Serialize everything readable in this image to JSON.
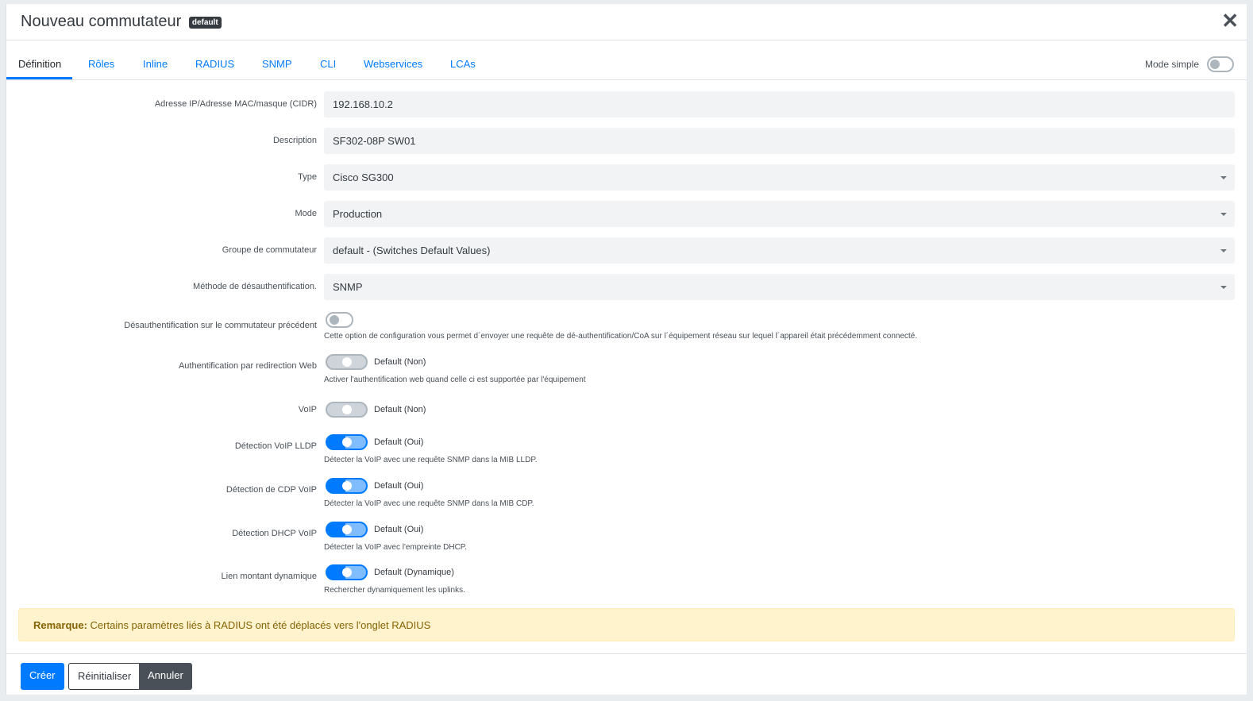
{
  "header": {
    "title": "Nouveau commutateur",
    "badge": "default",
    "close_symbol": "✕"
  },
  "tabs": [
    {
      "label": "Définition",
      "active": true
    },
    {
      "label": "Rôles"
    },
    {
      "label": "Inline"
    },
    {
      "label": "RADIUS"
    },
    {
      "label": "SNMP"
    },
    {
      "label": "CLI"
    },
    {
      "label": "Webservices"
    },
    {
      "label": "LCAs"
    }
  ],
  "mode_simple": {
    "label": "Mode simple",
    "enabled": false
  },
  "fields": {
    "ip": {
      "label": "Adresse IP/Adresse MAC/masque (CIDR)",
      "value": "192.168.10.2"
    },
    "description": {
      "label": "Description",
      "value": "SF302-08P SW01"
    },
    "type": {
      "label": "Type",
      "value": "Cisco SG300"
    },
    "mode": {
      "label": "Mode",
      "value": "Production"
    },
    "group": {
      "label": "Groupe de commutateur",
      "value": "default - (Switches Default Values)"
    },
    "deauth": {
      "label": "Méthode de désauthentification.",
      "value": "SNMP"
    }
  },
  "toggles": {
    "previous_switch": {
      "label": "Désauthentification sur le commutateur précédent",
      "state": "off",
      "help": "Cette option de configuration vous permet d´envoyer une requête de dé-authentification/CoA sur l´équipement réseau sur lequel l´appareil était précédemment connecté."
    },
    "web_auth": {
      "label": "Authentification par redirection Web",
      "state": "default-off",
      "text": "Default (Non)",
      "help": "Activer l'authentification web quand celle ci est supportée par l'équipement"
    },
    "voip": {
      "label": "VoIP",
      "state": "default-off",
      "text": "Default (Non)"
    },
    "lldp": {
      "label": "Détection VoIP LLDP",
      "state": "default-on",
      "text": "Default (Oui)",
      "help": "Détecter la VoIP avec une requête SNMP dans la MIB LLDP."
    },
    "cdp": {
      "label": "Détection de CDP VoIP",
      "state": "default-on",
      "text": "Default (Oui)",
      "help": "Détecter la VoIP avec une requête SNMP dans la MIB CDP."
    },
    "dhcp": {
      "label": "Détection DHCP VoIP",
      "state": "default-on",
      "text": "Default (Oui)",
      "help": "Détecter la VoIP avec l'empreinte DHCP."
    },
    "uplink": {
      "label": "Lien montant dynamique",
      "state": "default-on",
      "text": "Default (Dynamique)",
      "help": "Rechercher dynamiquement les uplinks."
    }
  },
  "alert": {
    "strong": "Remarque:",
    "text": " Certains paramètres liés à RADIUS ont été déplacés vers l'onglet RADIUS"
  },
  "buttons": {
    "create": "Créer",
    "reset": "Réinitialiser",
    "cancel": "Annuler"
  }
}
